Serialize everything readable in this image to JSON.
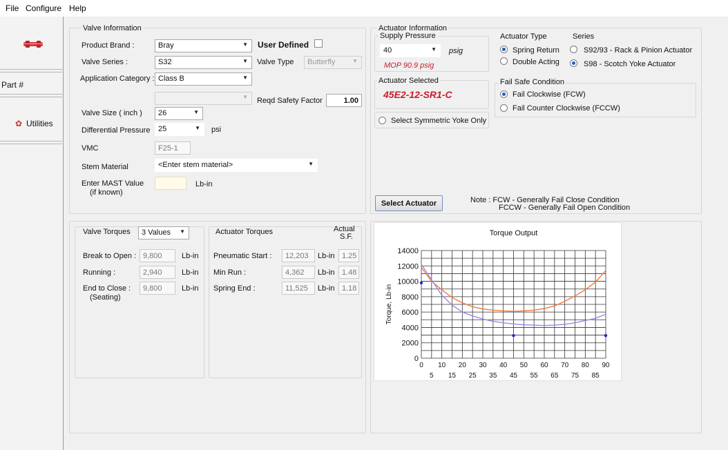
{
  "menu": [
    "File",
    "Configure",
    "Help"
  ],
  "sidebar": {
    "part_label": "Part #",
    "utilities_label": "Utilities"
  },
  "valve_info": {
    "group_title": "Valve Information",
    "product_brand_label": "Product Brand :",
    "product_brand": "Bray",
    "valve_series_label": "Valve Series  :",
    "valve_series": "S32",
    "user_defined_label": "User Defined",
    "valve_type_label": "Valve Type",
    "valve_type": "Butterfly",
    "application_category_label": "Application Category :",
    "application_category": "Class B",
    "reqd_safety_factor_label": "Reqd Safety Factor",
    "reqd_safety_factor": "1.00",
    "valve_size_label": "Valve Size ( inch )",
    "valve_size": "26",
    "differential_pressure_label": "Differential Pressure",
    "differential_pressure": "25",
    "psi_label": "psi",
    "vmc_label": "VMC",
    "vmc": "F25-1",
    "stem_material_label": "Stem Material",
    "stem_material_placeholder": "<Enter stem material>",
    "mast_label_1": "Enter MAST Value",
    "mast_label_2": "(if known)",
    "mast_unit": "Lb-in"
  },
  "actuator_info": {
    "group_title": "Actuator Information",
    "supply_pressure_label": "Supply Pressure",
    "supply_pressure": "40",
    "psig_label": "psig",
    "mop_text": "MOP  90.9   psig",
    "actuator_type_label": "Actuator Type",
    "spring_return_label": "Spring Return",
    "double_acting_label": "Double Acting",
    "series_label": "Series",
    "series_s92": "S92/93 - Rack & Pinion Actuator",
    "series_s98": "S98 - Scotch Yoke Actuator",
    "actuator_selected_label": "Actuator Selected",
    "actuator_selected": "45E2-12-SR1-C",
    "fail_safe_label": "Fail Safe Condition",
    "fail_cw_label": "Fail Clockwise (FCW)",
    "fail_ccw_label": "Fail Counter Clockwise (FCCW)",
    "symmetric_yoke_label": "Select Symmetric Yoke Only",
    "select_actuator_button": "Select Actuator",
    "note_1": "Note : FCW  - Generally Fail Close Condition",
    "note_2": "FCCW - Generally Fail Open Condition"
  },
  "torques": {
    "valve_torques_label": "Valve Torques",
    "values_option": "3 Values",
    "break_to_open_label": "Break to Open :",
    "break_to_open": "9,800",
    "running_label": "Running :",
    "running": "2,940",
    "end_to_close_label": "End to Close :",
    "end_to_close_sub": "(Seating)",
    "end_to_close": "9,800",
    "unit": "Lb-in",
    "actuator_torques_label": "Actuator Torques",
    "actual_label": "Actual",
    "sf_label": "S.F.",
    "pneumatic_start_label": "Pneumatic Start :",
    "pneumatic_start": "12,203",
    "pneumatic_start_sf": "1.25",
    "min_run_label": "Min Run  :",
    "min_run": "4,362",
    "min_run_sf": "1.48",
    "spring_end_label": "Spring End     :",
    "spring_end": "11,525",
    "spring_end_sf": "1.18"
  },
  "colors": {
    "accent_red": "#cc1a2b",
    "radio_blue": "#1f5fbf",
    "curve_orange": "#f07a3a",
    "curve_purple": "#9c86e8",
    "point_blue": "#1a2bd0"
  },
  "chart_data": {
    "type": "line",
    "title": "Torque Output",
    "ylabel": "Torque, Lb-in",
    "xlabel": "",
    "xlim": [
      0,
      90
    ],
    "ylim": [
      0,
      14000
    ],
    "x_ticks_top": [
      0,
      10,
      20,
      30,
      40,
      50,
      60,
      70,
      80,
      90
    ],
    "x_ticks_bottom": [
      5,
      15,
      25,
      35,
      45,
      55,
      65,
      75,
      85
    ],
    "y_ticks": [
      0,
      2000,
      4000,
      6000,
      8000,
      10000,
      12000,
      14000
    ],
    "grid": true,
    "series": [
      {
        "color": "#f07a3a",
        "style": "line",
        "x": [
          0,
          5,
          10,
          15,
          20,
          25,
          30,
          35,
          40,
          45,
          50,
          55,
          60,
          65,
          70,
          75,
          80,
          85,
          90
        ],
        "values": [
          11800,
          10000,
          8900,
          7900,
          7200,
          6700,
          6400,
          6250,
          6150,
          6100,
          6150,
          6250,
          6450,
          6800,
          7400,
          8100,
          8900,
          9900,
          11400
        ]
      },
      {
        "color": "#9c86e8",
        "style": "line",
        "x": [
          0,
          5,
          10,
          15,
          20,
          25,
          30,
          35,
          40,
          45,
          50,
          55,
          60,
          65,
          70,
          75,
          80,
          85,
          90
        ],
        "values": [
          12200,
          10200,
          8200,
          6900,
          6000,
          5500,
          5100,
          4800,
          4600,
          4450,
          4350,
          4300,
          4250,
          4300,
          4400,
          4600,
          4900,
          5200,
          5700
        ]
      },
      {
        "color": "#1a2bd0",
        "style": "points",
        "x": [
          0,
          45,
          90
        ],
        "values": [
          9800,
          2940,
          2940
        ]
      }
    ]
  }
}
